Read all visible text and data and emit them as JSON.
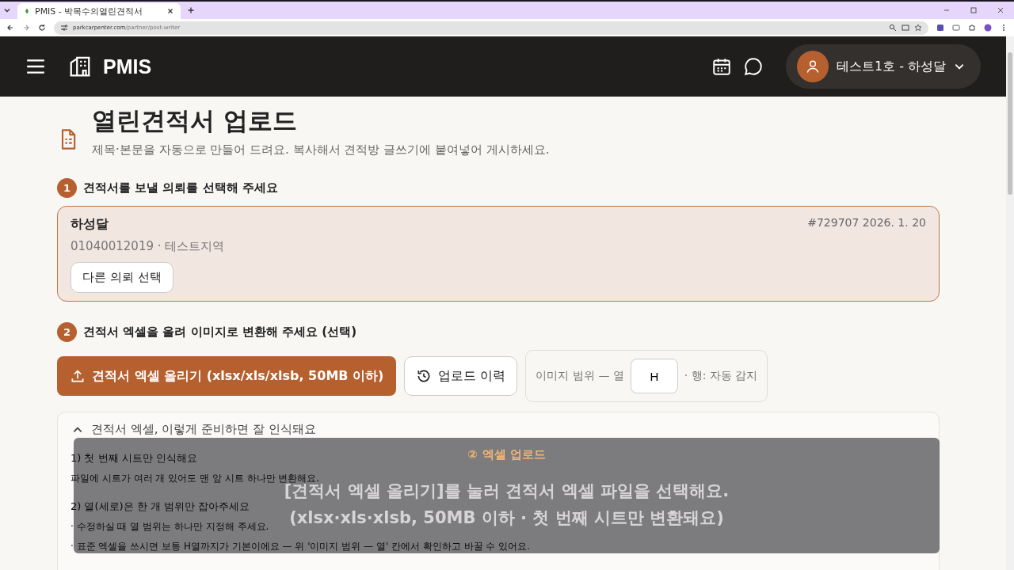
{
  "browser": {
    "tab_title": "PMIS - 박목수의열린견적서",
    "url_host": "parkcarpenter.com",
    "url_path": "/partner/post-writer"
  },
  "header": {
    "logo": "PMIS",
    "user": "테스트1호 - 하성달"
  },
  "page": {
    "title": "열린견적서 업로드",
    "subtitle": "제목·본문을 자동으로 만들어 드려요. 복사해서 견적방 글쓰기에 붙여넣어 게시하세요."
  },
  "step1": {
    "number": "1",
    "label": "견적서를 보낼 의뢰를 선택해 주세요",
    "client": {
      "name": "하성달",
      "meta": "#729707 2026. 1. 20",
      "detail": "01040012019 · 테스트지역",
      "button": "다른 의뢰 선택"
    }
  },
  "step2": {
    "number": "2",
    "label": "견적서 엑셀을 올려 이미지로 변환해 주세요 (선택)",
    "upload_button": "견적서 엑셀 올리기 (xlsx/xls/xlsb, 50MB 이하)",
    "history_button": "업로드 이력",
    "range_label": "이미지 범위 — 열",
    "range_value": "H",
    "range_suffix": "· 행: 자동 감지"
  },
  "guide": {
    "title": "견적서 엑셀, 이렇게 준비하면 잘 인식돼요",
    "expanded": true,
    "items": [
      {
        "kind": "heading",
        "text": "1) 첫 번째 시트만 인식해요"
      },
      {
        "kind": "line",
        "text": "파일에 시트가 여러 개 있어도 맨 앞 시트 하나만 변환해요."
      },
      {
        "kind": "heading",
        "text": "2) 열(세로)은 한 개 범위만 잡아주세요"
      },
      {
        "kind": "line",
        "text": "· 수정하실 때 열 범위는 하나만 지정해 주세요."
      },
      {
        "kind": "line",
        "text": "· 표준 엑셀을 쓰시면 보통 H열까지가 기본이에요 — 위 '이미지 범위 — 열' 칸에서 확인하고 바꿀 수 있어요."
      }
    ]
  },
  "coach": {
    "step": "②",
    "title": "엑셀 업로드",
    "line1": "[견적서 엑셀 올리기]를 눌러 견적서 엑셀 파일을 선택해요.",
    "line2": "(xlsx·xls·xlsb, 50MB 이하 · 첫 번째 시트만 변환돼요)"
  }
}
